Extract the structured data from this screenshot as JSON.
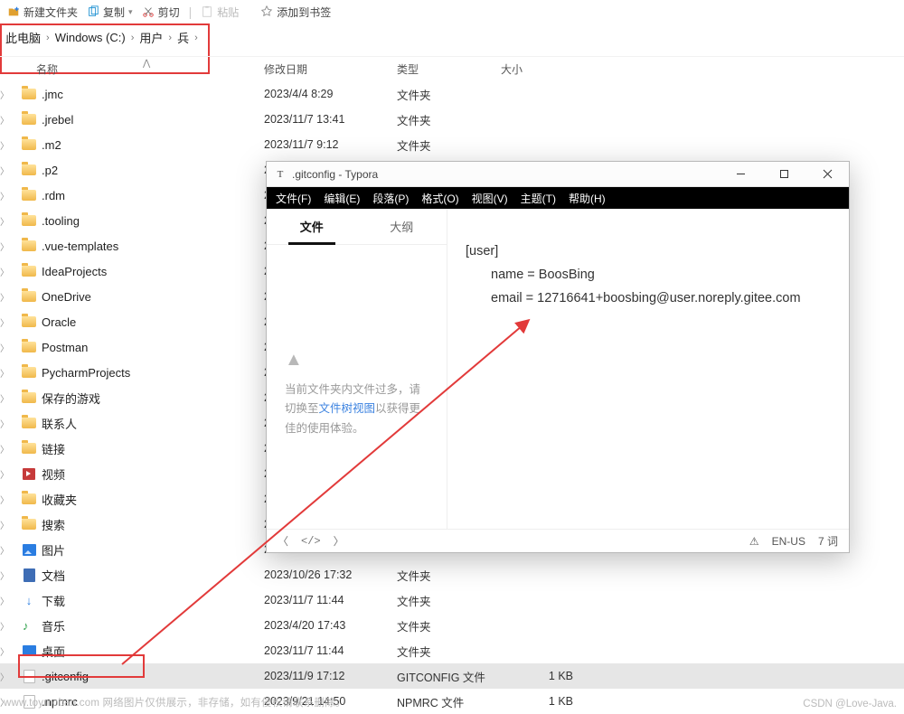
{
  "toolbar": {
    "new_folder": "新建文件夹",
    "copy": "复制",
    "cut": "剪切",
    "paste": "粘贴",
    "bookmark": "添加到书签"
  },
  "breadcrumb": [
    "此电脑",
    "Windows (C:)",
    "用户",
    "兵"
  ],
  "headers": {
    "name": "名称",
    "date": "修改日期",
    "type": "类型",
    "size": "大小"
  },
  "rows": [
    {
      "icon": "folder",
      "name": ".jmc",
      "date": "2023/4/4 8:29",
      "type": "文件夹",
      "size": ""
    },
    {
      "icon": "folder",
      "name": ".jrebel",
      "date": "2023/11/7 13:41",
      "type": "文件夹",
      "size": ""
    },
    {
      "icon": "folder",
      "name": ".m2",
      "date": "2023/11/7 9:12",
      "type": "文件夹",
      "size": ""
    },
    {
      "icon": "folder",
      "name": ".p2",
      "date": "2",
      "type": "",
      "size": ""
    },
    {
      "icon": "folder",
      "name": ".rdm",
      "date": "2",
      "type": "",
      "size": ""
    },
    {
      "icon": "folder",
      "name": ".tooling",
      "date": "2",
      "type": "",
      "size": ""
    },
    {
      "icon": "folder",
      "name": ".vue-templates",
      "date": "2",
      "type": "",
      "size": ""
    },
    {
      "icon": "folder",
      "name": "IdeaProjects",
      "date": "2",
      "type": "",
      "size": ""
    },
    {
      "icon": "folder",
      "name": "OneDrive",
      "date": "2",
      "type": "",
      "size": ""
    },
    {
      "icon": "folder",
      "name": "Oracle",
      "date": "2",
      "type": "",
      "size": ""
    },
    {
      "icon": "folder",
      "name": "Postman",
      "date": "2",
      "type": "",
      "size": ""
    },
    {
      "icon": "folder",
      "name": "PycharmProjects",
      "date": "2",
      "type": "",
      "size": ""
    },
    {
      "icon": "folder",
      "name": "保存的游戏",
      "date": "2",
      "type": "",
      "size": ""
    },
    {
      "icon": "folder",
      "name": "联系人",
      "date": "2",
      "type": "",
      "size": ""
    },
    {
      "icon": "folder",
      "name": "链接",
      "date": "2",
      "type": "",
      "size": ""
    },
    {
      "icon": "video",
      "name": "视频",
      "date": "2",
      "type": "",
      "size": ""
    },
    {
      "icon": "folder",
      "name": "收藏夹",
      "date": "2",
      "type": "",
      "size": ""
    },
    {
      "icon": "folder",
      "name": "搜索",
      "date": "2",
      "type": "",
      "size": ""
    },
    {
      "icon": "pic",
      "name": "图片",
      "date": "2",
      "type": "",
      "size": ""
    },
    {
      "icon": "doc",
      "name": "文档",
      "date": "2023/10/26 17:32",
      "type": "文件夹",
      "size": ""
    },
    {
      "icon": "dl",
      "name": "下载",
      "date": "2023/11/7 11:44",
      "type": "文件夹",
      "size": ""
    },
    {
      "icon": "music",
      "name": "音乐",
      "date": "2023/4/20 17:43",
      "type": "文件夹",
      "size": ""
    },
    {
      "icon": "desk",
      "name": "桌面",
      "date": "2023/11/7 11:44",
      "type": "文件夹",
      "size": ""
    },
    {
      "icon": "file",
      "name": ".gitconfig",
      "date": "2023/11/9 17:12",
      "type": "GITCONFIG 文件",
      "size": "1 KB",
      "selected": true
    },
    {
      "icon": "file",
      "name": ".npmrc",
      "date": "2023/9/21 14:50",
      "type": "NPMRC 文件",
      "size": "1 KB"
    }
  ],
  "typora": {
    "title": ".gitconfig - Typora",
    "menus": [
      "文件(F)",
      "编辑(E)",
      "段落(P)",
      "格式(O)",
      "视图(V)",
      "主题(T)",
      "帮助(H)"
    ],
    "tabs": {
      "file": "文件",
      "outline": "大纲"
    },
    "sidebar_warning_pre": "当前文件夹内文件过多，请切换至",
    "sidebar_warning_link": "文件树视图",
    "sidebar_warning_post": "以获得更佳的使用体验。",
    "content": {
      "l1": "[user]",
      "l2": "name = BoosBing",
      "l3": "email = 12716641+boosbing@user.noreply.gitee.com"
    },
    "status": {
      "lang": "EN-US",
      "words": "7 词"
    }
  },
  "watermark_left": "www.toymoban.com 网络图片仅供展示，非存储，如有侵权请联系删除。",
  "watermark_right": "CSDN @Love-Java."
}
